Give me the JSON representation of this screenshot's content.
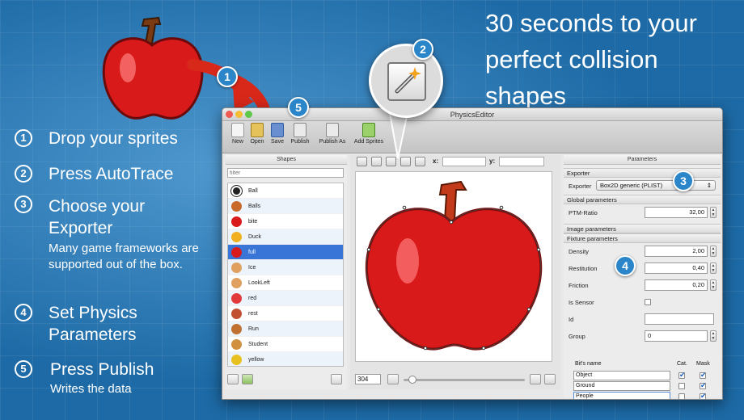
{
  "headline": {
    "line1": "30 seconds to your",
    "line2": "perfect collision",
    "line3": "shapes"
  },
  "steps": [
    {
      "num": "1",
      "title": "Drop your sprites",
      "sub": ""
    },
    {
      "num": "2",
      "title": "Press AutoTrace",
      "sub": ""
    },
    {
      "num": "3",
      "title": "Choose your Exporter",
      "sub": "Many game frameworks are supported out of the box."
    },
    {
      "num": "4",
      "title": "Set Physics Parameters",
      "sub": ""
    },
    {
      "num": "5",
      "title": "Press Publish",
      "sub": "Writes the data"
    }
  ],
  "callouts": [
    "1",
    "2",
    "3",
    "4",
    "5"
  ],
  "window": {
    "title": "PhysicsEditor",
    "toolbar": [
      "New",
      "Open",
      "Save",
      "Publish",
      "Publish As",
      "Add Sprites"
    ],
    "shapes": {
      "header": "Shapes",
      "filter_placeholder": "filter",
      "items": [
        "Ball",
        "Balls",
        "bite",
        "Duck",
        "full",
        "Ice",
        "LookLeft",
        "red",
        "rest",
        "Run",
        "Student",
        "yellow"
      ],
      "selected": "full"
    },
    "canvas": {
      "x_label": "x:",
      "y_label": "y:",
      "zoom": "304"
    },
    "parameters": {
      "header": "Parameters",
      "exporter_section": "Exporter",
      "exporter_label": "Exporter",
      "exporter_value": "Box2D generic (PLIST)",
      "global_section": "Global parameters",
      "ptm_label": "PTM-Ratio",
      "ptm_value": "32,00",
      "image_section": "Image parameters",
      "fixture_section": "Fixture parameters",
      "density_label": "Density",
      "density_value": "2,00",
      "restitution_label": "Restitution",
      "restitution_value": "0,40",
      "friction_label": "Friction",
      "friction_value": "0,20",
      "sensor_label": "Is Sensor",
      "id_label": "Id",
      "group_label": "Group",
      "group_value": "0",
      "bits_header": {
        "name": "Bit's name",
        "cat": "Cat.",
        "mask": "Mask"
      },
      "bits": [
        {
          "name": "Object",
          "cat": true,
          "mask": true
        },
        {
          "name": "Ground",
          "cat": false,
          "mask": true
        },
        {
          "name": "People",
          "cat": false,
          "mask": true
        }
      ]
    }
  },
  "colors": {
    "background": "#1d6aa6",
    "badge": "#2a86c9",
    "selection": "#3875d7",
    "apple": "#d81a1a"
  }
}
